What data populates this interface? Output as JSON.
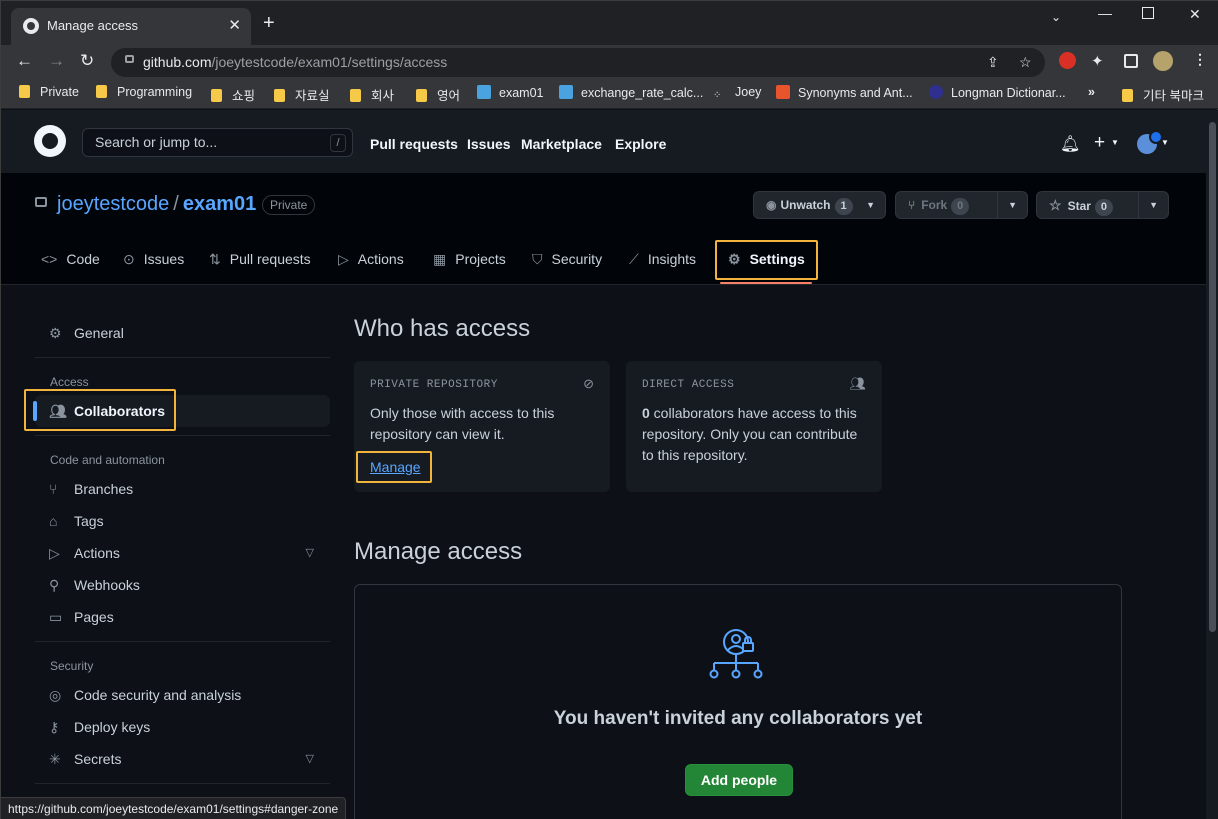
{
  "browser": {
    "tab_title": "Manage access",
    "new_tab": "+",
    "url_host": "github.com",
    "url_path": "/joeytestcode/exam01/settings/access",
    "status_url": "https://github.com/joeytestcode/exam01/settings#danger-zone",
    "bookmarks": [
      "Private",
      "Programming",
      "쇼핑",
      "자료실",
      "회사",
      "영어",
      "exam01",
      "exchange_rate_calc...",
      "Joey",
      "Synonyms and Ant...",
      "Longman Dictionar..."
    ],
    "bookmarks_more": "»",
    "other_bookmarks": "기타 북마크"
  },
  "github_header": {
    "search_placeholder": "Search or jump to...",
    "search_shortcut": "/",
    "nav": [
      "Pull requests",
      "Issues",
      "Marketplace",
      "Explore"
    ]
  },
  "repo": {
    "owner": "joeytestcode",
    "separator": "/",
    "name": "exam01",
    "visibility": "Private",
    "watch_label": "Unwatch",
    "watch_count": "1",
    "fork_label": "Fork",
    "fork_count": "0",
    "star_label": "Star",
    "star_count": "0",
    "tabs": [
      "Code",
      "Issues",
      "Pull requests",
      "Actions",
      "Projects",
      "Security",
      "Insights",
      "Settings"
    ]
  },
  "sidebar": {
    "general": "General",
    "access_heading": "Access",
    "collaborators": "Collaborators",
    "code_heading": "Code and automation",
    "code_items": [
      "Branches",
      "Tags",
      "Actions",
      "Webhooks",
      "Pages"
    ],
    "security_heading": "Security",
    "security_items": [
      "Code security and analysis",
      "Deploy keys",
      "Secrets"
    ]
  },
  "main": {
    "who_title": "Who has access",
    "private_card": {
      "heading": "PRIVATE REPOSITORY",
      "body_line1": "Only those with access to this",
      "body_line2": "repository can view it.",
      "link": "Manage"
    },
    "direct_card": {
      "heading": "DIRECT ACCESS",
      "count": "0",
      "body_line1": " collaborators have access to this",
      "body_line2": "repository. Only you can contribute",
      "body_line3": "to this repository."
    },
    "manage_title": "Manage access",
    "empty_title": "You haven't invited any collaborators yet",
    "add_button": "Add people"
  },
  "colors": {
    "accent_link": "#58a6ff",
    "highlight_box": "#f2b43c",
    "button_green": "#238636",
    "tab_underline": "#f78166"
  }
}
